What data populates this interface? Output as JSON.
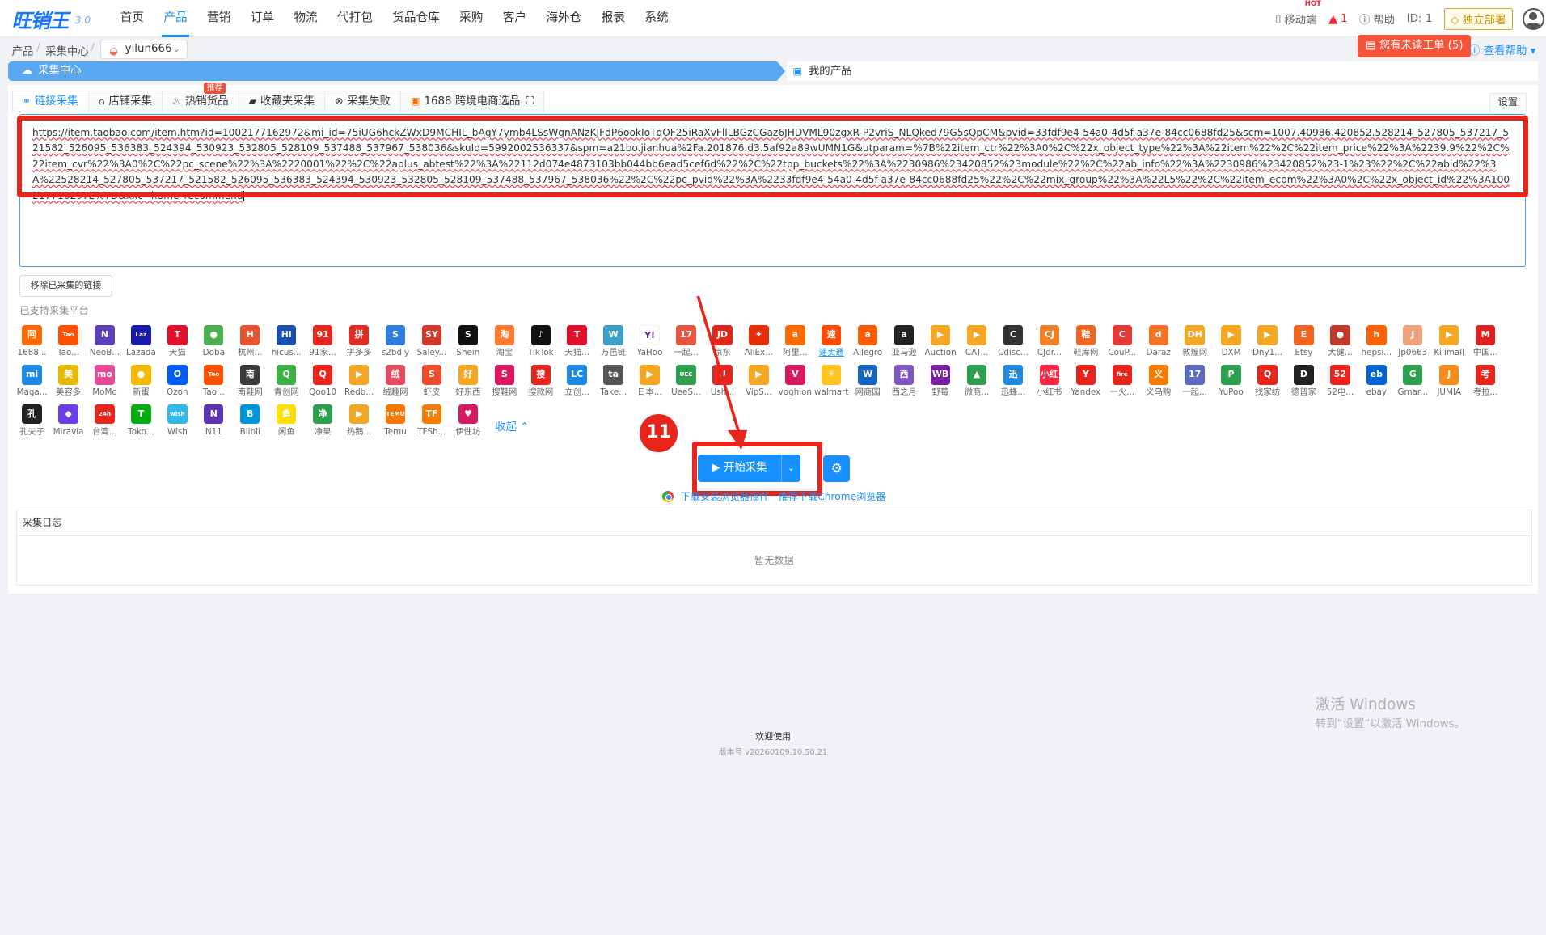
{
  "app": {
    "logo": "旺销王",
    "version": "3.0"
  },
  "nav": {
    "items": [
      "首页",
      "产品",
      "营销",
      "订单",
      "物流",
      "代打包",
      "货品仓库",
      "采购",
      "客户",
      "海外仓",
      "报表",
      "系统"
    ],
    "active": 1
  },
  "topright": {
    "mobile": "移动端",
    "hot": "HOT",
    "alerts": "1",
    "help": "帮助",
    "id": "ID: 1",
    "deploy": "独立部署"
  },
  "breadcrumb": {
    "root": "产品",
    "section": "采集中心",
    "shop": "yilun666"
  },
  "ticket": "您有未读工单 (5)",
  "help_link": "查看帮助",
  "steps": {
    "current": "采集中心",
    "next": "我的产品"
  },
  "tabs": [
    {
      "label": "链接采集",
      "icon": "link-icon"
    },
    {
      "label": "店铺采集",
      "icon": "shop-icon"
    },
    {
      "label": "热销货品",
      "icon": "fire-icon",
      "badge": "推荐"
    },
    {
      "label": "收藏夹采集",
      "icon": "folder-icon"
    },
    {
      "label": "采集失败",
      "icon": "fail-icon"
    },
    {
      "label": "1688 跨境电商选品",
      "icon": "1688-icon"
    }
  ],
  "settings_tab": "设置",
  "url_input": {
    "value": "https://item.taobao.com/item.htm?id=1002177162972&mi_id=75iUG6hckZWxD9MCHIL_bAgY7ymb4LSsWgnANzKJFdP6ookIoTqOF25iRaXvFllLBGzCGaz6JHDVML90zgxR-P2vriS_NLQked79G5sQpCM&pvid=33fdf9e4-54a0-4d5f-a37e-84cc0688fd25&scm=1007.40986.420852.528214_527805_537217_521582_526095_536383_524394_530923_532805_528109_537488_537967_538036&skuId=5992002536337&spm=a21bo.jianhua%2Fa.201876.d3.5af92a89wUMN1G&utparam=%7B%22item_ctr%22%3A0%2C%22x_object_type%22%3A%22item%22%2C%22item_price%22%3A%2239.9%22%2C%22item_cvr%22%3A0%2C%22pc_scene%22%3A%2220001%22%2C%22aplus_abtest%22%3A%22112d074e4873103bb044bb6ead5cef6d%22%2C%22tpp_buckets%22%3A%2230986%23420852%23module%22%2C%22ab_info%22%3A%2230986%23420852%23-1%23%22%2C%22abid%22%3A%22528214_527805_537217_521582_526095_536383_524394_530923_532805_528109_537488_537967_538036%22%2C%22pc_pvid%22%3A%2233fdf9e4-54a0-4d5f-a37e-84cc0688fd25%22%2C%22mix_group%22%3A%22L5%22%2C%22item_ecpm%22%3A0%2C%22x_object_id%22%3A1002177162972%7D&xxc=home_recommend"
  },
  "remove_button": "移除已采集的链接",
  "platforms_label": "已支持采集平台",
  "platforms": [
    {
      "name": "1688...",
      "mark": "阿",
      "color": "#ff6a00"
    },
    {
      "name": "Tao...",
      "mark": "Tao",
      "color": "#ff5000"
    },
    {
      "name": "NeoB...",
      "mark": "N",
      "color": "#5a3fb5"
    },
    {
      "name": "Lazada",
      "mark": "Laz",
      "color": "#1a1aa8"
    },
    {
      "name": "天猫",
      "mark": "T",
      "color": "#e0102a"
    },
    {
      "name": "Doba",
      "mark": "●",
      "color": "#4caf50"
    },
    {
      "name": "杭州...",
      "mark": "H",
      "color": "#e8542f"
    },
    {
      "name": "hicus...",
      "mark": "Hi",
      "color": "#1a4fb0"
    },
    {
      "name": "91家...",
      "mark": "91",
      "color": "#e8251c"
    },
    {
      "name": "拼多多",
      "mark": "拼",
      "color": "#e02e24"
    },
    {
      "name": "s2bdiy",
      "mark": "S",
      "color": "#2f7de1"
    },
    {
      "name": "Saley...",
      "mark": "SY",
      "color": "#d4362a"
    },
    {
      "name": "Shein",
      "mark": "S",
      "color": "#111111"
    },
    {
      "name": "淘宝",
      "mark": "淘",
      "color": "#ff7a2f"
    },
    {
      "name": "TikTok",
      "mark": "♪",
      "color": "#111111"
    },
    {
      "name": "天猫...",
      "mark": "T",
      "color": "#e0102a"
    },
    {
      "name": "万邑链",
      "mark": "W",
      "color": "#3aa0c8"
    },
    {
      "name": "YaHoo",
      "mark": "Y!",
      "color": "#ffffff"
    },
    {
      "name": "一起...",
      "mark": "17",
      "color": "#e8543f"
    },
    {
      "name": "京东",
      "mark": "JD",
      "color": "#e1251b"
    },
    {
      "name": "AliEx...",
      "mark": "✦",
      "color": "#e62e04"
    },
    {
      "name": "阿里...",
      "mark": "a",
      "color": "#ff6a00"
    },
    {
      "name": "速卖通",
      "mark": "速",
      "color": "#ff4a00"
    },
    {
      "name": "Allegro",
      "mark": "a",
      "color": "#ff5a00"
    },
    {
      "name": "亚马逊",
      "mark": "a",
      "color": "#222222"
    },
    {
      "name": "Auction",
      "mark": "▶",
      "color": "#f5a623"
    },
    {
      "name": "CAT...",
      "mark": "▶",
      "color": "#f5a623"
    },
    {
      "name": "Cdisc...",
      "mark": "C",
      "color": "#333333"
    },
    {
      "name": "CJdr...",
      "mark": "CJ",
      "color": "#f27e26"
    },
    {
      "name": "鞋库网",
      "mark": "鞋",
      "color": "#f26522"
    },
    {
      "name": "CouP...",
      "mark": "C",
      "color": "#e53935"
    },
    {
      "name": "Daraz",
      "mark": "d",
      "color": "#f57224"
    },
    {
      "name": "敦煌网",
      "mark": "DH",
      "color": "#f6a623"
    },
    {
      "name": "DXM",
      "mark": "▶",
      "color": "#f5a623"
    },
    {
      "name": "Dny1...",
      "mark": "▶",
      "color": "#f5a623"
    },
    {
      "name": "Etsy",
      "mark": "E",
      "color": "#f16521"
    },
    {
      "name": "大健...",
      "mark": "●",
      "color": "#c0392b"
    },
    {
      "name": "hepsi...",
      "mark": "h",
      "color": "#ff6000"
    },
    {
      "name": "Jp0663",
      "mark": "J",
      "color": "#f0a07a"
    },
    {
      "name": "Kilimall",
      "mark": "▶",
      "color": "#f5a623"
    },
    {
      "name": "中国...",
      "mark": "M",
      "color": "#e02020"
    },
    {
      "name": "Maga...",
      "mark": "mi",
      "color": "#1e88e5"
    },
    {
      "name": "美容多",
      "mark": "美",
      "color": "#e6b800"
    },
    {
      "name": "MoMo",
      "mark": "mo",
      "color": "#e84a9a"
    },
    {
      "name": "新蛋",
      "mark": "●",
      "color": "#f5b800"
    },
    {
      "name": "Ozon",
      "mark": "O",
      "color": "#005bff"
    },
    {
      "name": "Tao...",
      "mark": "Tao",
      "color": "#ff5000"
    },
    {
      "name": "南鞋网",
      "mark": "南",
      "color": "#3a3a3a"
    },
    {
      "name": "青创网",
      "mark": "Q",
      "color": "#3cb043"
    },
    {
      "name": "Qoo10",
      "mark": "Q",
      "color": "#e8251c"
    },
    {
      "name": "Redb...",
      "mark": "▶",
      "color": "#f5a623"
    },
    {
      "name": "绒趣网",
      "mark": "绒",
      "color": "#e84a5f"
    },
    {
      "name": "虾皮",
      "mark": "S",
      "color": "#ee4d2d"
    },
    {
      "name": "好东西",
      "mark": "好",
      "color": "#f5a623"
    },
    {
      "name": "搜鞋网",
      "mark": "S",
      "color": "#d81b60"
    },
    {
      "name": "搜款网",
      "mark": "搜",
      "color": "#e8251c"
    },
    {
      "name": "立创...",
      "mark": "LC",
      "color": "#1e88e5"
    },
    {
      "name": "Take...",
      "mark": "ta",
      "color": "#555555"
    },
    {
      "name": "日本...",
      "mark": "▶",
      "color": "#f5a623"
    },
    {
      "name": "UeeS...",
      "mark": "UEE",
      "color": "#2e9e4f"
    },
    {
      "name": "Ush...",
      "mark": "U",
      "color": "#e8251c"
    },
    {
      "name": "VipS...",
      "mark": "▶",
      "color": "#f5a623"
    },
    {
      "name": "voghion",
      "mark": "V",
      "color": "#d81b60"
    },
    {
      "name": "walmart",
      "mark": "✳",
      "color": "#ffc220"
    },
    {
      "name": "网商园",
      "mark": "W",
      "color": "#1565c0"
    },
    {
      "name": "西之月",
      "mark": "西",
      "color": "#7e57c2"
    },
    {
      "name": "野莓",
      "mark": "WB",
      "color": "#7b1fa2"
    },
    {
      "name": "微商...",
      "mark": "▲",
      "color": "#2e9e4f"
    },
    {
      "name": "迅蜂...",
      "mark": "迅",
      "color": "#1e88e5"
    },
    {
      "name": "小红书",
      "mark": "小红",
      "color": "#ff2442"
    },
    {
      "name": "Yandex",
      "mark": "Y",
      "color": "#e8251c"
    },
    {
      "name": "一火...",
      "mark": "fire",
      "color": "#e8251c"
    },
    {
      "name": "义乌购",
      "mark": "义",
      "color": "#f57c00"
    },
    {
      "name": "一起...",
      "mark": "17",
      "color": "#5c6bc0"
    },
    {
      "name": "YuPoo",
      "mark": "P",
      "color": "#2e9e4f"
    },
    {
      "name": "找家纺",
      "mark": "Q",
      "color": "#e8251c"
    },
    {
      "name": "德普家",
      "mark": "D",
      "color": "#222222"
    },
    {
      "name": "52电...",
      "mark": "52",
      "color": "#e8251c"
    },
    {
      "name": "ebay",
      "mark": "eb",
      "color": "#0064d2"
    },
    {
      "name": "Gmar...",
      "mark": "G",
      "color": "#2e9e4f"
    },
    {
      "name": "JUMIA",
      "mark": "J",
      "color": "#f68b1e"
    },
    {
      "name": "考拉...",
      "mark": "考",
      "color": "#e8251c"
    },
    {
      "name": "孔夫子",
      "mark": "孔",
      "color": "#222222"
    },
    {
      "name": "Miravia",
      "mark": "◆",
      "color": "#6a3de8"
    },
    {
      "name": "台湾...",
      "mark": "24h",
      "color": "#e8251c"
    },
    {
      "name": "Toko...",
      "mark": "T",
      "color": "#03ac0e"
    },
    {
      "name": "Wish",
      "mark": "wish",
      "color": "#2fb7ec"
    },
    {
      "name": "N11",
      "mark": "N",
      "color": "#5e35b1"
    },
    {
      "name": "Blibli",
      "mark": "B",
      "color": "#0095da"
    },
    {
      "name": "闲鱼",
      "mark": "鱼",
      "color": "#ffdf00"
    },
    {
      "name": "净果",
      "mark": "净",
      "color": "#2e9e4f"
    },
    {
      "name": "热鹅...",
      "mark": "▶",
      "color": "#f5a623"
    },
    {
      "name": "Temu",
      "mark": "TEMU",
      "color": "#fb7701"
    },
    {
      "name": "TFSh...",
      "mark": "TF",
      "color": "#f57c00"
    },
    {
      "name": "伊性坊",
      "mark": "♥",
      "color": "#d81b60"
    }
  ],
  "collapse": "收起",
  "start_button": "开始采集",
  "step_number": "11",
  "chrome": {
    "download_plugin": "下载安装浏览器插件",
    "download_chrome": "推荐下载Chrome浏览器"
  },
  "log": {
    "title": "采集日志",
    "empty": "暂无数据"
  },
  "footer": {
    "welcome": "欢迎使用",
    "version": "版本号 v20260109.10.50.21"
  },
  "watermark": {
    "line1": "激活 Windows",
    "line2": "转到“设置”以激活 Windows。"
  }
}
